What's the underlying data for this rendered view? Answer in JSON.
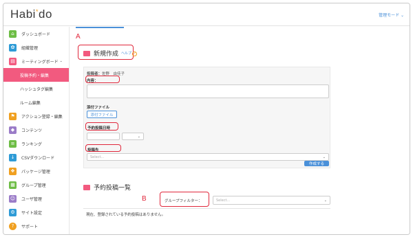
{
  "app": {
    "logo_pre": "Habi",
    "logo_star": "*",
    "logo_post": "do",
    "admin_mode": "管理モード ⌄"
  },
  "sidebar": {
    "items": [
      {
        "label": "ダッシュボード",
        "icon": "home-icon",
        "color": "#6dbd45"
      },
      {
        "label": "組織管理",
        "icon": "org-icon",
        "color": "#2e9bd6"
      },
      {
        "label": "ミーティングボード",
        "icon": "meeting-icon",
        "color": "#f25a7f"
      },
      {
        "label": "投稿予約・編集"
      },
      {
        "label": "ハッシュタグ編集"
      },
      {
        "label": "ルーム編集"
      },
      {
        "label": "アクション登録・編集",
        "icon": "flag-icon",
        "color": "#f0a020"
      },
      {
        "label": "コンテンツ",
        "icon": "content-icon",
        "color": "#9b7cc8"
      },
      {
        "label": "ランキング",
        "icon": "ranking-icon",
        "color": "#6dbd45"
      },
      {
        "label": "CSVダウンロード",
        "icon": "download-icon",
        "color": "#2e9bd6"
      },
      {
        "label": "パッケージ管理",
        "icon": "package-icon",
        "color": "#f0a020"
      },
      {
        "label": "グループ管理",
        "icon": "group-icon",
        "color": "#6dbd45"
      },
      {
        "label": "ユーザ管理",
        "icon": "user-icon",
        "color": "#9b7cc8"
      },
      {
        "label": "サイト設定",
        "icon": "settings-icon",
        "color": "#2e9bd6"
      },
      {
        "label": "サポート",
        "icon": "support-icon",
        "color": "#f0a020"
      }
    ]
  },
  "new_post": {
    "title": "新規作成",
    "help": "ヘルプ",
    "poster_label": "投稿者：",
    "poster_name": "佐野　由佳子",
    "content_label": "内容：",
    "attach_label": "添付ファイル",
    "attach_button": "添付ファイル",
    "schedule_label": "予約投稿日時",
    "dest_label": "投稿先",
    "dest_placeholder": "Select...",
    "create_button": "作成する"
  },
  "scheduled": {
    "title": "予約投稿一覧",
    "filter_label": "グループフィルター：",
    "filter_placeholder": "Select...",
    "empty_text": "現在、登録されている予約投稿はありません。"
  },
  "annotations": {
    "a": "A",
    "b": "B"
  },
  "colors": {
    "accent": "#f25a7f",
    "primary": "#4a90d9",
    "annotation": "#e0263a"
  }
}
